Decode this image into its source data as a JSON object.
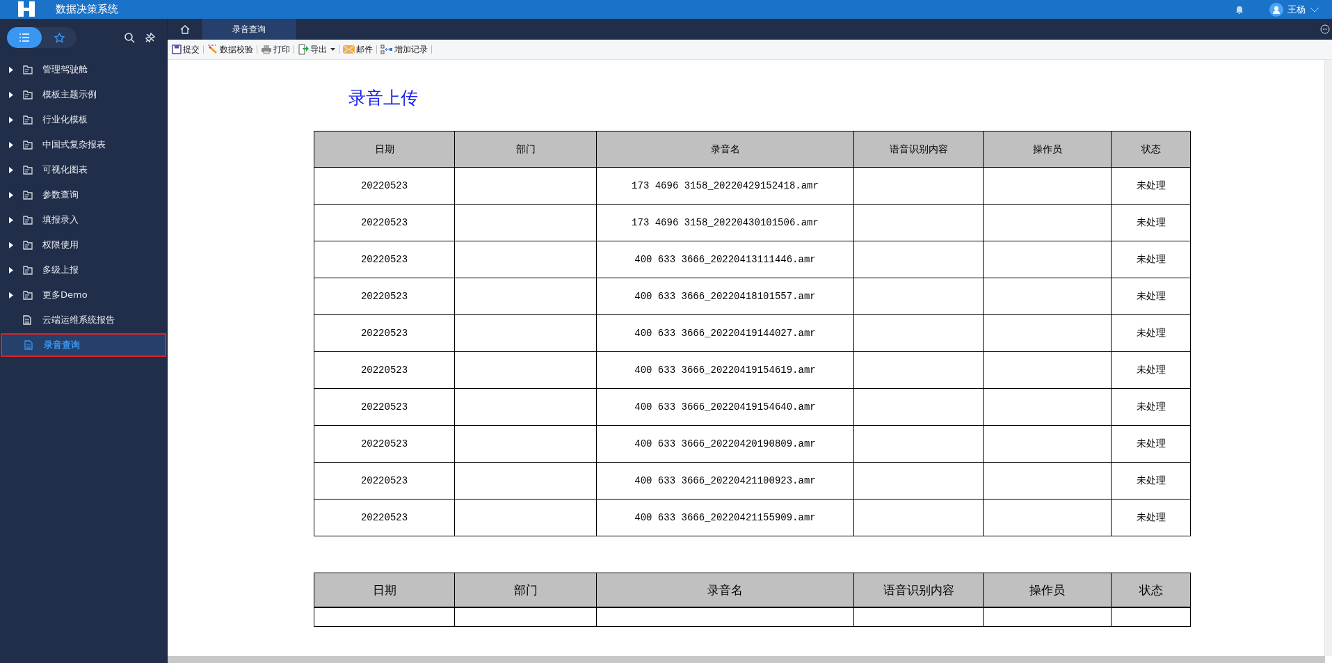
{
  "app": {
    "title": "数据决策系统",
    "user": "王杨"
  },
  "sidebar": {
    "modes": [
      {
        "kind": "list",
        "selected": true
      },
      {
        "kind": "favorites",
        "selected": false
      }
    ],
    "items": [
      {
        "label": "管理驾驶舱",
        "kind": "folder",
        "selected": false
      },
      {
        "label": "模板主题示例",
        "kind": "folder",
        "selected": false
      },
      {
        "label": "行业化模板",
        "kind": "folder",
        "selected": false
      },
      {
        "label": "中国式复杂报表",
        "kind": "folder",
        "selected": false
      },
      {
        "label": "可视化图表",
        "kind": "folder",
        "selected": false
      },
      {
        "label": "参数查询",
        "kind": "folder",
        "selected": false
      },
      {
        "label": "填报录入",
        "kind": "folder",
        "selected": false
      },
      {
        "label": "权限使用",
        "kind": "folder",
        "selected": false
      },
      {
        "label": "多级上报",
        "kind": "folder",
        "selected": false
      },
      {
        "label": "更多Demo",
        "kind": "folder",
        "selected": false
      },
      {
        "label": "云端运维系统报告",
        "kind": "report",
        "selected": false
      },
      {
        "label": "录音查询",
        "kind": "report",
        "selected": true
      }
    ]
  },
  "tabs": [
    {
      "label": "录音查询",
      "selected": true
    }
  ],
  "toolbar": [
    {
      "label": "提交",
      "kind": "save",
      "dropdown": false
    },
    {
      "label": "数据校验",
      "kind": "verify",
      "dropdown": false
    },
    {
      "label": "打印",
      "kind": "print",
      "dropdown": false
    },
    {
      "label": "导出",
      "kind": "export",
      "dropdown": true
    },
    {
      "label": "邮件",
      "kind": "mail",
      "dropdown": false
    },
    {
      "label": "增加记录",
      "kind": "add",
      "dropdown": false
    }
  ],
  "report": {
    "title": "录音上传",
    "columns": [
      "日期",
      "部门",
      "录音名",
      "语音识别内容",
      "操作员",
      "状态"
    ],
    "rows": [
      {
        "date": "20220523",
        "recording": "173 4696 3158_20220429152418.amr",
        "status": "未处理"
      },
      {
        "date": "20220523",
        "recording": "173 4696 3158_20220430101506.amr",
        "status": "未处理"
      },
      {
        "date": "20220523",
        "recording": "400 633 3666_20220413111446.amr",
        "status": "未处理"
      },
      {
        "date": "20220523",
        "recording": "400 633 3666_20220418101557.amr",
        "status": "未处理"
      },
      {
        "date": "20220523",
        "recording": "400 633 3666_20220419144027.amr",
        "status": "未处理"
      },
      {
        "date": "20220523",
        "recording": "400 633 3666_20220419154619.amr",
        "status": "未处理"
      },
      {
        "date": "20220523",
        "recording": "400 633 3666_20220419154640.amr",
        "status": "未处理"
      },
      {
        "date": "20220523",
        "recording": "400 633 3666_20220420190809.amr",
        "status": "未处理"
      },
      {
        "date": "20220523",
        "recording": "400 633 3666_20220421100923.amr",
        "status": "未处理"
      },
      {
        "date": "20220523",
        "recording": "400 633 3666_20220421155909.amr",
        "status": "未处理"
      }
    ]
  },
  "entry_table": {
    "columns": [
      "日期",
      "部门",
      "录音名",
      "语音识别内容",
      "操作员",
      "状态"
    ]
  }
}
